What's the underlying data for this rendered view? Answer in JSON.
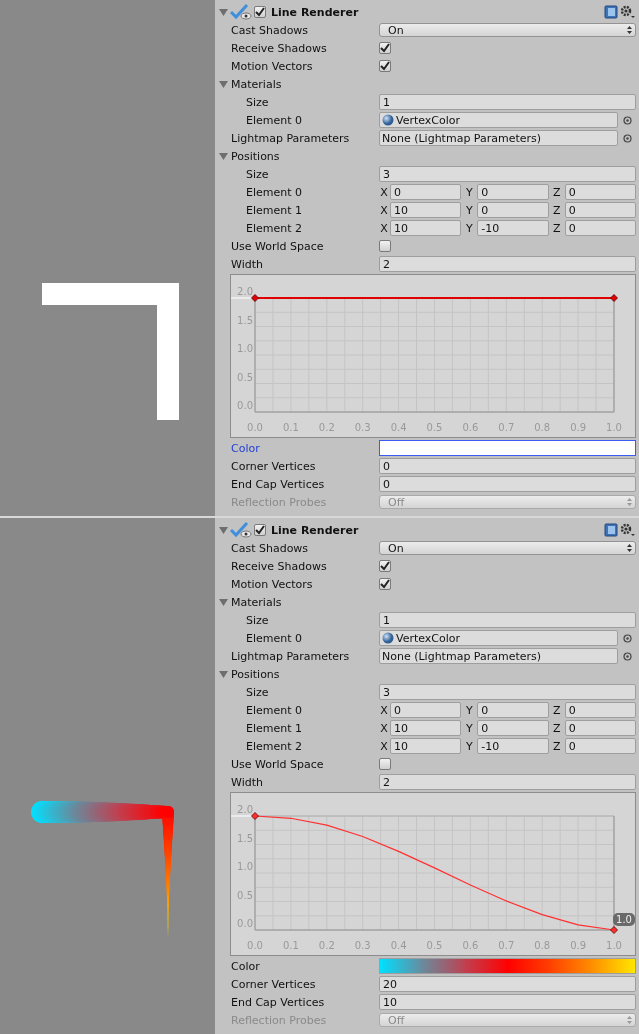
{
  "panels": [
    {
      "component": {
        "title": "Line Renderer",
        "enabled": true,
        "expanded": true
      },
      "rows": [
        {
          "kind": "dropdown",
          "label": "Cast Shadows",
          "value": "On",
          "disabled": false
        },
        {
          "kind": "checkbox",
          "label": "Receive Shadows",
          "checked": true
        },
        {
          "kind": "checkbox",
          "label": "Motion Vectors",
          "checked": true
        },
        {
          "kind": "foldout",
          "label": "Materials",
          "expanded": true,
          "children": [
            {
              "kind": "field",
              "label": "Size",
              "value": "1"
            },
            {
              "kind": "material",
              "label": "Element 0",
              "value": "VertexColor"
            }
          ]
        },
        {
          "kind": "object",
          "label": "Lightmap Parameters",
          "value": "None (Lightmap Parameters)"
        },
        {
          "kind": "foldout",
          "label": "Positions",
          "expanded": true,
          "children": [
            {
              "kind": "field",
              "label": "Size",
              "value": "3"
            },
            {
              "kind": "vector",
              "label": "Element 0",
              "components": [
                {
                  "axis": "X",
                  "value": "0"
                },
                {
                  "axis": "Y",
                  "value": "0"
                },
                {
                  "axis": "Z",
                  "value": "0"
                }
              ]
            },
            {
              "kind": "vector",
              "label": "Element 1",
              "components": [
                {
                  "axis": "X",
                  "value": "10"
                },
                {
                  "axis": "Y",
                  "value": "0"
                },
                {
                  "axis": "Z",
                  "value": "0"
                }
              ]
            },
            {
              "kind": "vector",
              "label": "Element 2",
              "components": [
                {
                  "axis": "X",
                  "value": "10"
                },
                {
                  "axis": "Y",
                  "value": "-10"
                },
                {
                  "axis": "Z",
                  "value": "0"
                }
              ]
            }
          ]
        },
        {
          "kind": "checkbox",
          "label": "Use World Space",
          "checked": false
        },
        {
          "kind": "field",
          "label": "Width",
          "value": "2"
        },
        {
          "kind": "curve",
          "chart_data": {
            "type": "line",
            "x": [
              0,
              1
            ],
            "grid": true,
            "series": [
              {
                "color": "#e00000",
                "marker": "diamond",
                "values": [
                  2,
                  2
                ]
              }
            ],
            "xlim": [
              0,
              1
            ],
            "ylim": [
              0,
              2
            ],
            "xticks": [
              {
                "value": 0,
                "label": "0.0"
              },
              {
                "value": 0.1,
                "label": "0.1"
              },
              {
                "value": 0.2,
                "label": "0.2"
              },
              {
                "value": 0.3,
                "label": "0.3"
              },
              {
                "value": 0.4,
                "label": "0.4"
              },
              {
                "value": 0.5,
                "label": "0.5"
              },
              {
                "value": 0.6,
                "label": "0.6"
              },
              {
                "value": 0.7,
                "label": "0.7"
              },
              {
                "value": 0.8,
                "label": "0.8"
              },
              {
                "value": 0.9,
                "label": "0.9"
              },
              {
                "value": 1,
                "label": "1.0"
              }
            ],
            "yticks": [
              {
                "value": 0,
                "label": "0.0"
              },
              {
                "value": 0.5,
                "label": "0.5"
              },
              {
                "value": 1,
                "label": "1.0"
              },
              {
                "value": 1.5,
                "label": "1.5"
              },
              {
                "value": 2,
                "label": "2.0"
              }
            ]
          }
        },
        {
          "kind": "color",
          "label": "Color",
          "focused": true,
          "gradient": [
            {
              "color": "#ffffff"
            }
          ]
        },
        {
          "kind": "field",
          "label": "Corner Vertices",
          "value": "0"
        },
        {
          "kind": "field",
          "label": "End Cap Vertices",
          "value": "0"
        },
        {
          "kind": "dropdown",
          "label": "Reflection Probes",
          "value": "Off",
          "disabled": true
        }
      ]
    },
    {
      "component": {
        "title": "Line Renderer",
        "enabled": true,
        "expanded": true
      },
      "rows": [
        {
          "kind": "dropdown",
          "label": "Cast Shadows",
          "value": "On",
          "disabled": false
        },
        {
          "kind": "checkbox",
          "label": "Receive Shadows",
          "checked": true
        },
        {
          "kind": "checkbox",
          "label": "Motion Vectors",
          "checked": true
        },
        {
          "kind": "foldout",
          "label": "Materials",
          "expanded": true,
          "children": [
            {
              "kind": "field",
              "label": "Size",
              "value": "1"
            },
            {
              "kind": "material",
              "label": "Element 0",
              "value": "VertexColor"
            }
          ]
        },
        {
          "kind": "object",
          "label": "Lightmap Parameters",
          "value": "None (Lightmap Parameters)"
        },
        {
          "kind": "foldout",
          "label": "Positions",
          "expanded": true,
          "children": [
            {
              "kind": "field",
              "label": "Size",
              "value": "3"
            },
            {
              "kind": "vector",
              "label": "Element 0",
              "components": [
                {
                  "axis": "X",
                  "value": "0"
                },
                {
                  "axis": "Y",
                  "value": "0"
                },
                {
                  "axis": "Z",
                  "value": "0"
                }
              ]
            },
            {
              "kind": "vector",
              "label": "Element 1",
              "components": [
                {
                  "axis": "X",
                  "value": "10"
                },
                {
                  "axis": "Y",
                  "value": "0"
                },
                {
                  "axis": "Z",
                  "value": "0"
                }
              ]
            },
            {
              "kind": "vector",
              "label": "Element 2",
              "components": [
                {
                  "axis": "X",
                  "value": "10"
                },
                {
                  "axis": "Y",
                  "value": "-10"
                },
                {
                  "axis": "Z",
                  "value": "0"
                }
              ]
            }
          ]
        },
        {
          "kind": "checkbox",
          "label": "Use World Space",
          "checked": false
        },
        {
          "kind": "field",
          "label": "Width",
          "value": "2"
        },
        {
          "kind": "curve",
          "tag": "1.0",
          "chart_data": {
            "type": "line",
            "x": [
              0,
              0.1,
              0.2,
              0.3,
              0.4,
              0.5,
              0.6,
              0.7,
              0.8,
              0.9,
              1
            ],
            "grid": true,
            "series": [
              {
                "color": "#ff3030",
                "values": [
                  2,
                  1.96,
                  1.84,
                  1.64,
                  1.38,
                  1.09,
                  0.79,
                  0.51,
                  0.27,
                  0.09,
                  0
                ]
              }
            ],
            "xlim": [
              0,
              1
            ],
            "ylim": [
              0,
              2
            ],
            "xticks": [
              {
                "value": 0,
                "label": "0.0"
              },
              {
                "value": 0.1,
                "label": "0.1"
              },
              {
                "value": 0.2,
                "label": "0.2"
              },
              {
                "value": 0.3,
                "label": "0.3"
              },
              {
                "value": 0.4,
                "label": "0.4"
              },
              {
                "value": 0.5,
                "label": "0.5"
              },
              {
                "value": 0.6,
                "label": "0.6"
              },
              {
                "value": 0.7,
                "label": "0.7"
              },
              {
                "value": 0.8,
                "label": "0.8"
              },
              {
                "value": 0.9,
                "label": "0.9"
              },
              {
                "value": 1,
                "label": "1.0"
              }
            ],
            "yticks": [
              {
                "value": 0,
                "label": "0.0"
              },
              {
                "value": 0.5,
                "label": "0.5"
              },
              {
                "value": 1,
                "label": "1.0"
              },
              {
                "value": 1.5,
                "label": "1.5"
              },
              {
                "value": 2,
                "label": "2.0"
              }
            ]
          }
        },
        {
          "kind": "color",
          "label": "Color",
          "focused": false,
          "gradient": [
            {
              "color": "#00e0ff"
            },
            {
              "color": "#6a8a9c"
            },
            {
              "color": "#c04050"
            },
            {
              "color": "#ff0000"
            },
            {
              "color": "#ff4000"
            },
            {
              "color": "#ff9000"
            },
            {
              "color": "#ffe800"
            }
          ]
        },
        {
          "kind": "field",
          "label": "Corner Vertices",
          "value": "20"
        },
        {
          "kind": "field",
          "label": "End Cap Vertices",
          "value": "10"
        },
        {
          "kind": "dropdown",
          "label": "Reflection Probes",
          "value": "Off",
          "disabled": true
        }
      ]
    }
  ]
}
